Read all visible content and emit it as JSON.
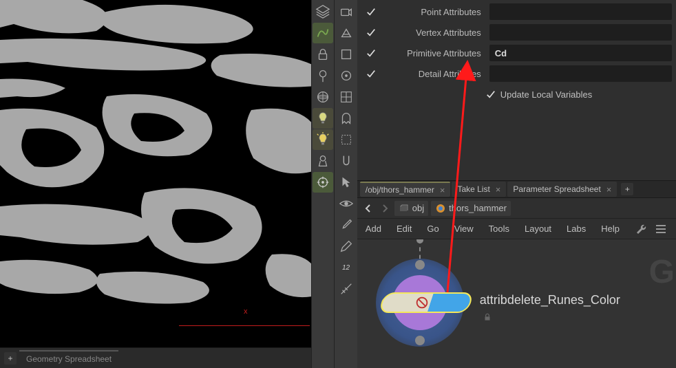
{
  "bottom_tab": {
    "label": "Geometry Spreadsheet"
  },
  "params": {
    "point": {
      "label": "Point Attributes",
      "value": ""
    },
    "vertex": {
      "label": "Vertex Attributes",
      "value": ""
    },
    "primitive": {
      "label": "Primitive Attributes",
      "value": "Cd"
    },
    "detail": {
      "label": "Detail Attributes",
      "value": ""
    },
    "update_vars": {
      "label": "Update Local Variables"
    }
  },
  "tabs": {
    "t0": "/obj/thors_hammer",
    "t1": "Take List",
    "t2": "Parameter Spreadsheet"
  },
  "path": {
    "c0": "obj",
    "c1": "thors_hammer"
  },
  "menus": {
    "add": "Add",
    "edit": "Edit",
    "go": "Go",
    "view": "View",
    "tools": "Tools",
    "layout": "Layout",
    "labs": "Labs",
    "help": "Help"
  },
  "node": {
    "label": "attribdelete_Runes_Color"
  },
  "axis": {
    "x": "x"
  },
  "big_letter": "G",
  "tool_12": "12"
}
